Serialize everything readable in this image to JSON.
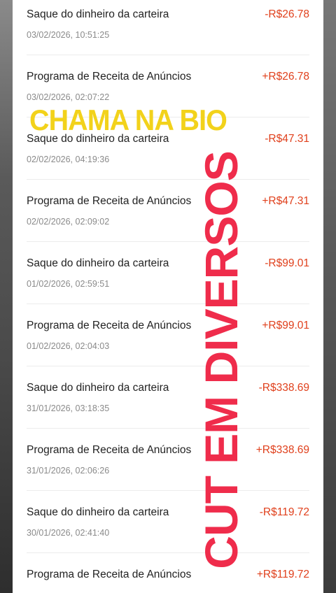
{
  "transactions": [
    {
      "title": "Saque do dinheiro da carteira",
      "date": "03/02/2026, 10:51:25",
      "amount": "-R$26.78"
    },
    {
      "title": "Programa de Receita de Anúncios",
      "date": "03/02/2026, 02:07:22",
      "amount": "+R$26.78"
    },
    {
      "title": "Saque do dinheiro da carteira",
      "date": "02/02/2026, 04:19:36",
      "amount": "-R$47.31"
    },
    {
      "title": "Programa de Receita de Anúncios",
      "date": "02/02/2026, 02:09:02",
      "amount": "+R$47.31"
    },
    {
      "title": "Saque do dinheiro da carteira",
      "date": "01/02/2026, 02:59:51",
      "amount": "-R$99.01"
    },
    {
      "title": "Programa de Receita de Anúncios",
      "date": "01/02/2026, 02:04:03",
      "amount": "+R$99.01"
    },
    {
      "title": "Saque do dinheiro da carteira",
      "date": "31/01/2026, 03:18:35",
      "amount": "-R$338.69"
    },
    {
      "title": "Programa de Receita de Anúncios",
      "date": "31/01/2026, 02:06:26",
      "amount": "+R$338.69"
    },
    {
      "title": "Saque do dinheiro da carteira",
      "date": "30/01/2026, 02:41:40",
      "amount": "-R$119.72"
    },
    {
      "title": "Programa de Receita de Anúncios",
      "date": "",
      "amount": "+R$119.72"
    }
  ],
  "overlay": {
    "top_text": "CHAMA NA BIO",
    "side_text": "CUT EM DIVERSOS"
  },
  "colors": {
    "amount": "#e0401c",
    "overlay_yellow": "#f2d21b",
    "overlay_red": "#ef2c4b"
  }
}
